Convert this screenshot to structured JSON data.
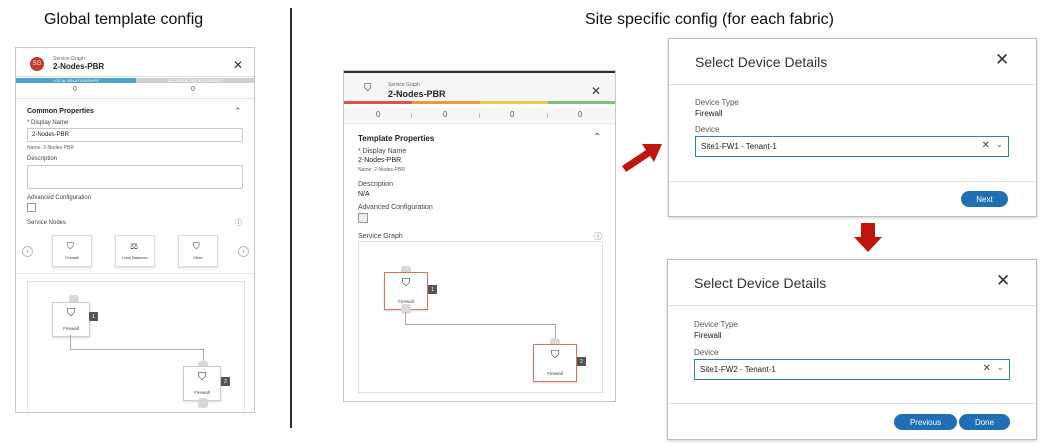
{
  "headings": {
    "global": "Global template config",
    "site": "Site specific config (for each fabric)"
  },
  "global_panel": {
    "logo_text": "SG",
    "subtitle": "Service Graph",
    "title": "2-Nodes-PBR",
    "tabs": {
      "local": "LOCAL RELATIONSHIPS",
      "external": "EXTERNAL RELATIONSHIPS"
    },
    "counts": {
      "local": "0",
      "external": "0"
    },
    "common_properties": "Common Properties",
    "display_name_label": "* Display Name",
    "display_name_value": "2-Nodes-PBR",
    "name_line": "Name: 2-Nodes-PBR",
    "description_label": "Description",
    "advanced_config_label": "Advanced Configuration",
    "service_nodes_label": "Service Nodes",
    "service_nodes": [
      {
        "label": "Firewall",
        "icon": "shield-icon"
      },
      {
        "label": "Load Balancer",
        "icon": "load-balancer-icon"
      },
      {
        "label": "Other",
        "icon": "shield-icon"
      }
    ],
    "graph_nodes": [
      {
        "label": "Firewall",
        "number": "1"
      },
      {
        "label": "Firewall",
        "number": "2"
      }
    ]
  },
  "site_panel": {
    "subtitle": "Service Graph",
    "title": "2-Nodes-PBR",
    "counts": [
      "0",
      "0",
      "0",
      "0",
      "0"
    ],
    "color_segments": [
      "#d9534f",
      "#e99a3b",
      "#e8c848",
      "#7cc07c",
      "#4aa3c9"
    ],
    "template_properties": "Template Properties",
    "display_name_label": "* Display Name",
    "display_name_value": "2-Nodes-PBR",
    "name_line": "Name: 2-Nodes-PBR",
    "description_label": "Description",
    "description_value": "N/A",
    "advanced_config_label": "Advanced Configuration",
    "service_graph_label": "Service Graph",
    "graph_nodes": [
      {
        "label": "Firewall",
        "number": "1"
      },
      {
        "label": "Firewall",
        "number": "2"
      }
    ]
  },
  "dialog1": {
    "title": "Select Device Details",
    "device_type_label": "Device Type",
    "device_type_value": "Firewall",
    "device_label": "Device",
    "device_value": "Site1-FW1 - Tenant-1",
    "next_label": "Next"
  },
  "dialog2": {
    "title": "Select Device Details",
    "device_type_label": "Device Type",
    "device_type_value": "Firewall",
    "device_label": "Device",
    "device_value": "Site1-FW2 - Tenant-1",
    "previous_label": "Previous",
    "done_label": "Done"
  },
  "colors": {
    "accent_red": "#c0140e",
    "button_blue": "#1f6fb5",
    "select_border": "#2d7fc6",
    "node_highlight": "#d9735e"
  }
}
